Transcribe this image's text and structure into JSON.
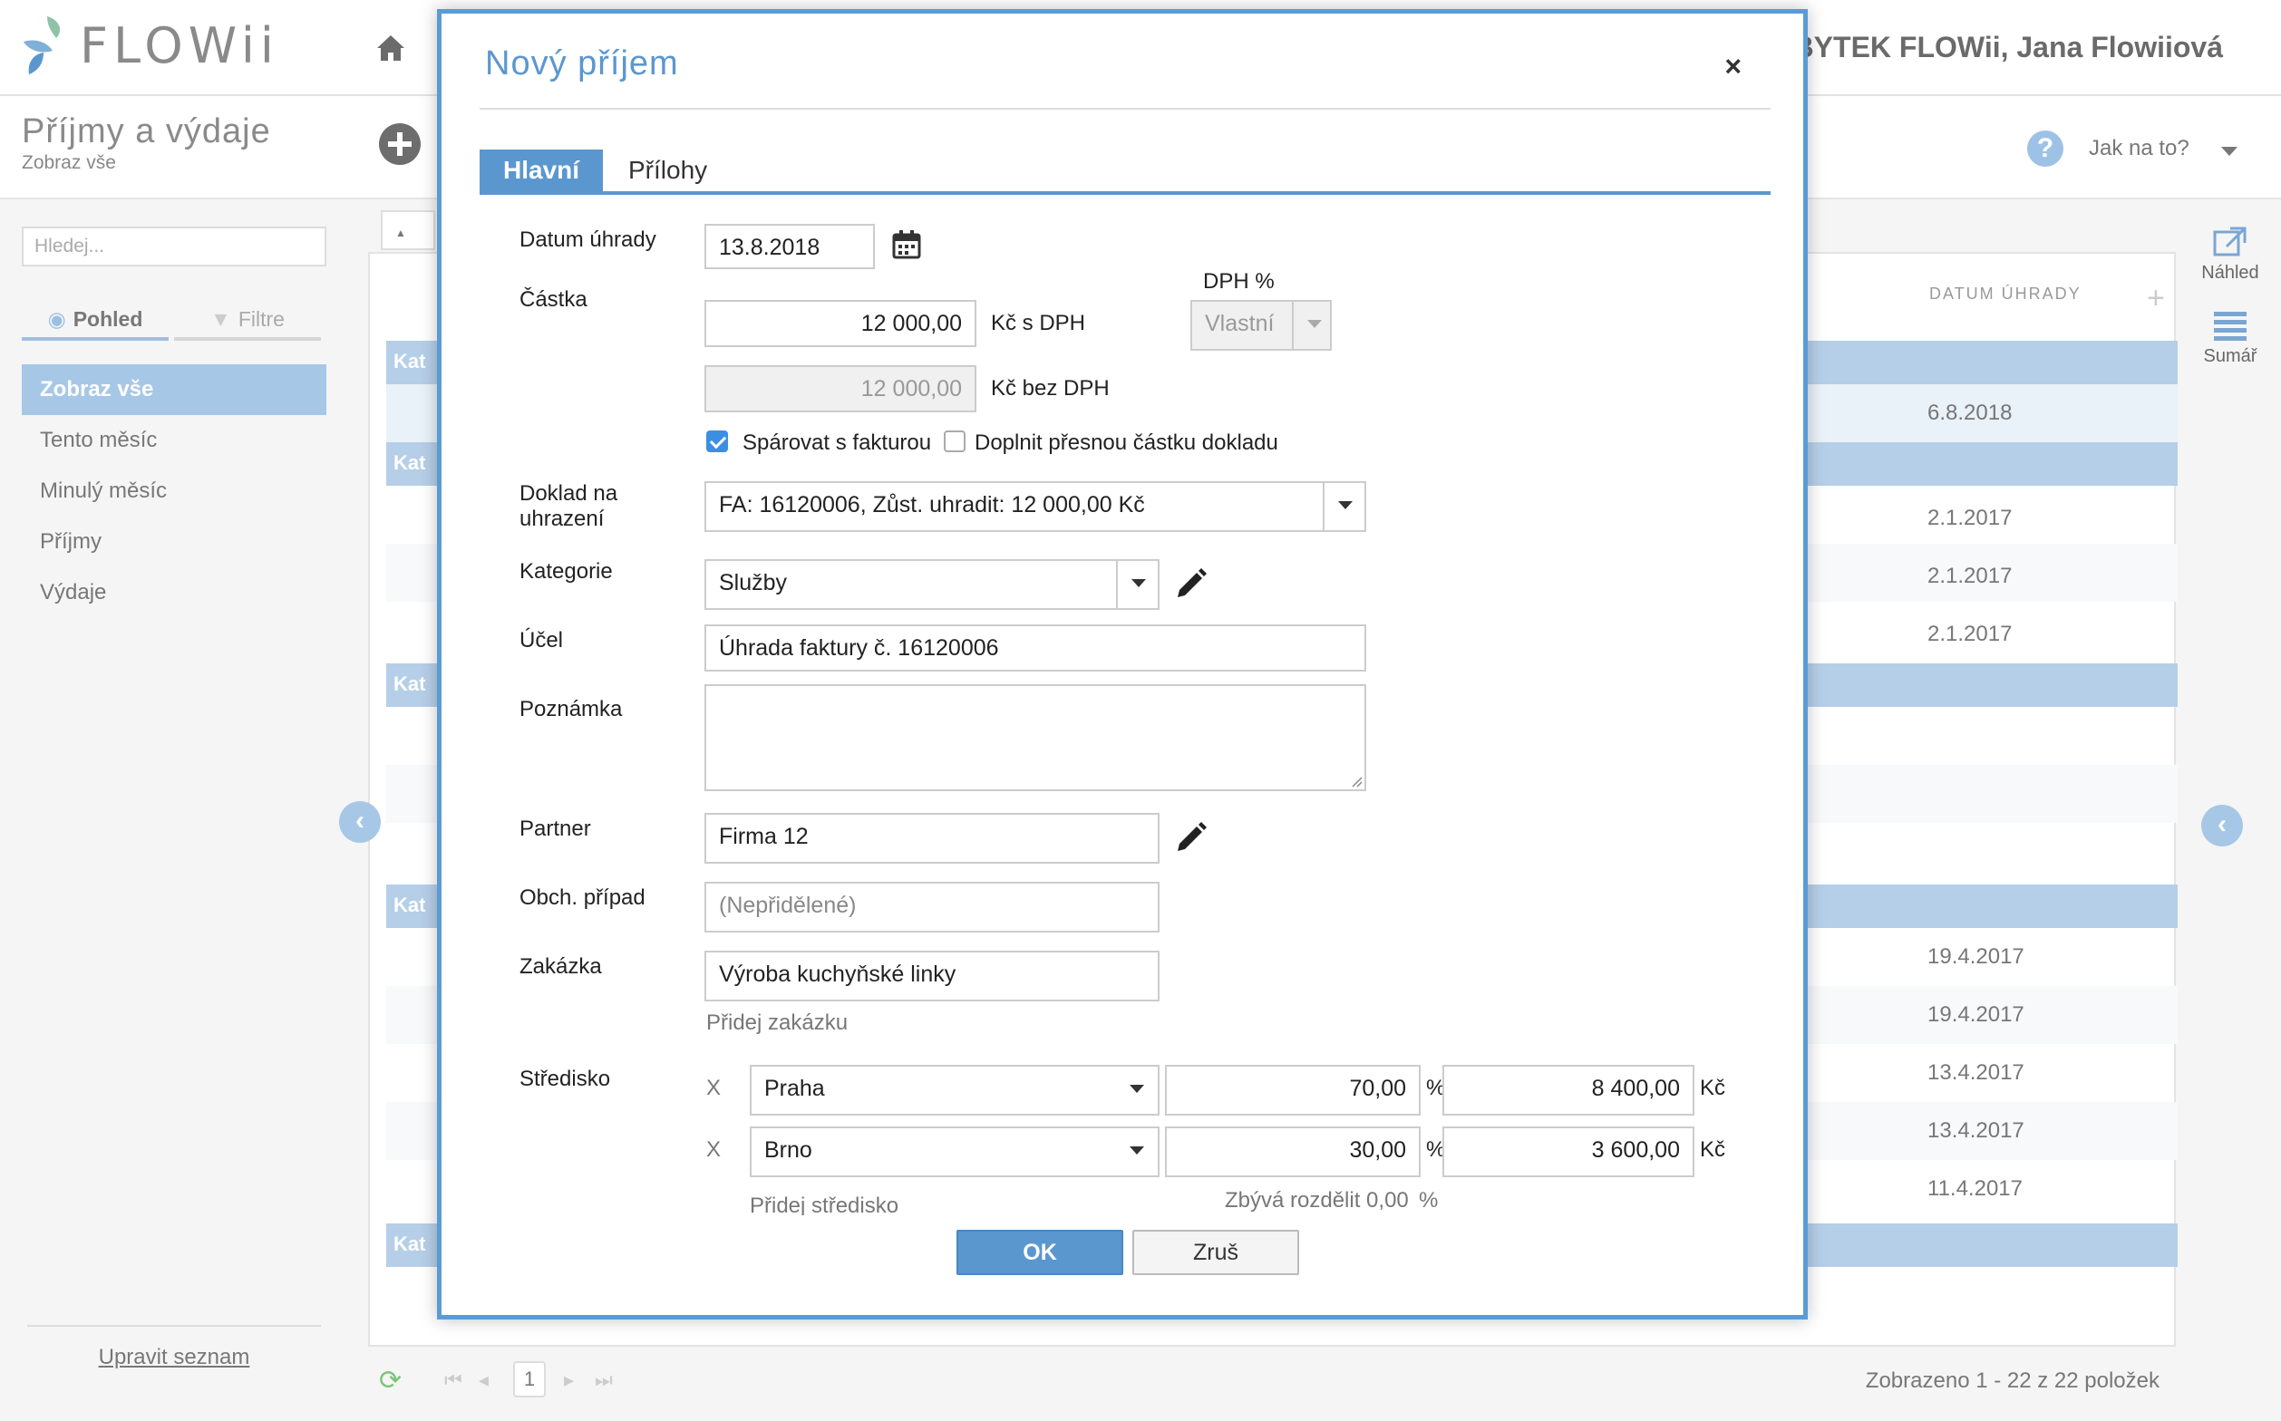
{
  "header": {
    "logo_text": "FLOWii",
    "user_name": "ÁBYTEK FLOWii, Jana Flowiiová"
  },
  "subheader": {
    "title": "Příjmy a výdaje",
    "subtitle": "Zobraz vše",
    "help_label": "Jak na to?"
  },
  "sidebar": {
    "search_placeholder": "Hledej...",
    "tabs": [
      {
        "label": "Pohled"
      },
      {
        "label": "Filtre"
      }
    ],
    "items": [
      {
        "label": "Zobraz vše"
      },
      {
        "label": "Tento měsíc"
      },
      {
        "label": "Minulý měsíc"
      },
      {
        "label": "Příjmy"
      },
      {
        "label": "Výdaje"
      }
    ],
    "edit_list": "Upravit seznam"
  },
  "table": {
    "kat_button": "Ka",
    "date_header": "DATUM ÚHRADY",
    "group_label": "Kat",
    "dates": [
      "6.8.2018",
      "2.1.2017",
      "2.1.2017",
      "2.1.2017",
      "19.4.2017",
      "19.4.2017",
      "13.4.2017",
      "13.4.2017",
      "11.4.2017"
    ],
    "pager": {
      "page": "1",
      "info": "Zobrazeno 1 - 22 z 22 položek"
    }
  },
  "right_rail": {
    "preview": "Náhled",
    "summary": "Sumář"
  },
  "modal": {
    "title": "Nový příjem",
    "close": "×",
    "tabs": {
      "main": "Hlavní",
      "attachments": "Přílohy"
    },
    "labels": {
      "datum": "Datum úhrady",
      "castka": "Částka",
      "dph": "DPH %",
      "doklad_1": "Doklad na",
      "doklad_2": "uhrazení",
      "kategorie": "Kategorie",
      "ucel": "Účel",
      "poznamka": "Poznámka",
      "partner": "Partner",
      "obch": "Obch. případ",
      "zakazka": "Zakázka",
      "stredisko": "Středisko"
    },
    "values": {
      "datum": "13.8.2018",
      "castka_s_dph": "12 000,00",
      "castka_bez_dph": "12 000,00",
      "unit_s_dph": "Kč  s DPH",
      "unit_bez_dph": "Kč  bez DPH",
      "dph_select": "Vlastní",
      "check_sparovat": "Spárovat s fakturou",
      "check_doplnit": "Doplnit přesnou částku dokladu",
      "doklad": "FA: 16120006, Zůst. uhradit: 12 000,00 Kč",
      "kategorie": "Služby",
      "ucel": "Úhrada faktury č. 16120006",
      "partner": "Firma 12",
      "obch_placeholder": "(Nepřidělené)",
      "zakazka": "Výroba kuchyňské linky",
      "add_zakazka": "Přidej zakázku",
      "add_stredisko": "Přidej středisko",
      "remaining": "Zbývá rozdělit 0,00",
      "percent": "%",
      "currency": "Kč",
      "remove": "X"
    },
    "strediska": [
      {
        "name": "Praha",
        "percent": "70,00",
        "amount": "8 400,00"
      },
      {
        "name": "Brno",
        "percent": "30,00",
        "amount": "3 600,00"
      }
    ],
    "buttons": {
      "ok": "OK",
      "cancel": "Zruš"
    }
  }
}
